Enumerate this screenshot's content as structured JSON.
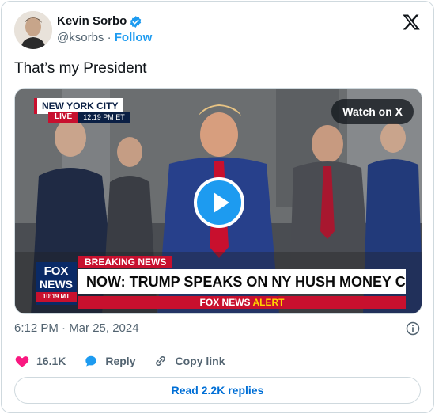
{
  "author": {
    "name": "Kevin Sorbo",
    "handle": "@ksorbs",
    "separator": "·",
    "follow_label": "Follow"
  },
  "tweet": {
    "text": "That’s my President",
    "timestamp": "6:12 PM · Mar 25, 2024"
  },
  "media": {
    "watch_label": "Watch on X",
    "location_tag": "NEW YORK CITY",
    "live_tag": "LIVE",
    "time_tag": "12:19 PM ET",
    "breaking_label": "BREAKING NEWS",
    "headline": "NOW: TRUMP SPEAKS ON NY HUSH MONEY CASE",
    "network_line1": "FOX",
    "network_line2": "NEWS",
    "network_time": "10:19 MT",
    "alert_prefix": "FOX NEWS",
    "alert_word": "ALERT"
  },
  "actions": {
    "likes": "16.1K",
    "reply_label": "Reply",
    "copy_label": "Copy link",
    "read_replies_label": "Read 2.2K replies"
  },
  "colors": {
    "accent": "#1d9bf0",
    "like": "#f91880",
    "link": "#006fd6"
  },
  "icons": {
    "verified": "verified-badge-icon",
    "x_logo": "x-logo-icon",
    "heart": "heart-icon",
    "reply": "reply-bubble-icon",
    "link": "link-icon",
    "info": "info-icon",
    "play": "play-icon"
  }
}
